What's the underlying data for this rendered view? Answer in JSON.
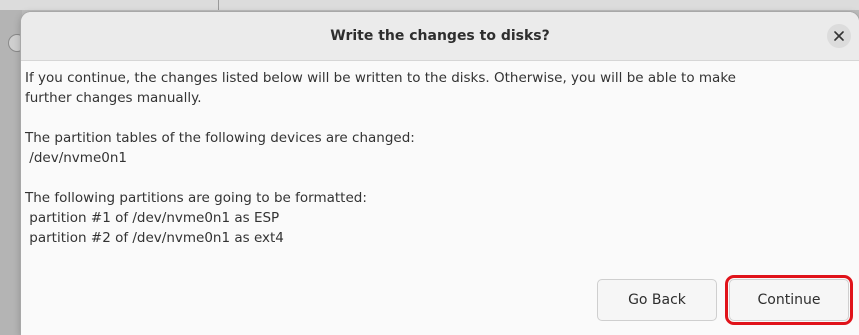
{
  "dialog": {
    "title": "Write the changes to disks?",
    "close_icon": "close-icon",
    "intro_line1": "If you continue, the changes listed below will be written to the disks. Otherwise, you will be able to make",
    "intro_line2": "further changes manually.",
    "tables_heading": "The partition tables of the following devices are changed:",
    "tables_devices": [
      " /dev/nvme0n1"
    ],
    "format_heading": "The following partitions are going to be formatted:",
    "format_partitions": [
      " partition #1 of /dev/nvme0n1 as ESP",
      " partition #2 of /dev/nvme0n1 as ext4"
    ],
    "buttons": {
      "go_back": "Go Back",
      "continue": "Continue"
    },
    "highlight_color": "#e0131a"
  }
}
